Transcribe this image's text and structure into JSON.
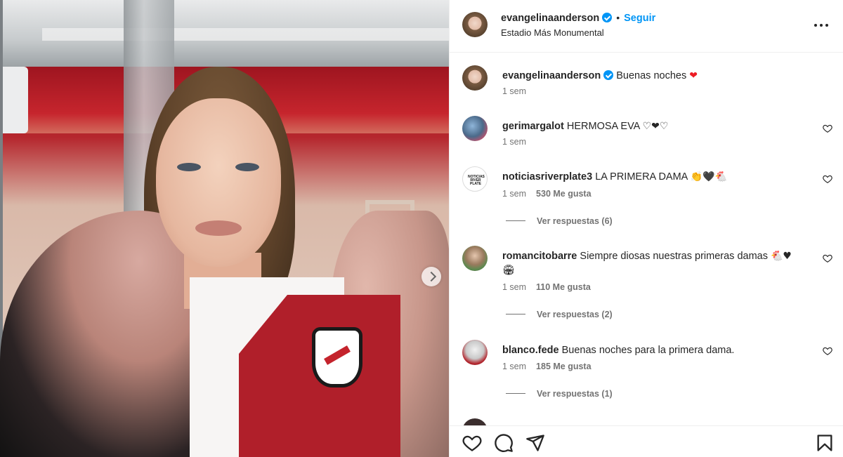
{
  "header": {
    "username": "evangelinaanderson",
    "follow_label": "Seguir",
    "separator": "•",
    "location": "Estadio Más Monumental",
    "more_icon": "more-horizontal-icon"
  },
  "caption": {
    "username": "evangelinaanderson",
    "text": "Buenas noches",
    "emoji": "❤",
    "time": "1 sem"
  },
  "comments": [
    {
      "username": "gerimargalot",
      "text": "HERMOSA EVA",
      "emoji": "♡❤♡",
      "time": "1 sem",
      "likes": ""
    },
    {
      "username": "noticiasriverplate3",
      "text": "LA PRIMERA DAMA",
      "emoji": "👏🖤🐔",
      "time": "1 sem",
      "likes": "530 Me gusta",
      "replies": "Ver respuestas (6)",
      "avatar_text": "NOTICIAS RIVER PLATE"
    },
    {
      "username": "romancitobarre",
      "text": "Siempre diosas nuestras primeras damas",
      "emoji": "🐔♥",
      "emoji2": "🏟",
      "time": "1 sem",
      "likes": "110 Me gusta",
      "replies": "Ver respuestas (2)"
    },
    {
      "username": "blanco.fede",
      "text": "Buenas noches para la primera dama.",
      "emoji": "",
      "time": "1 sem",
      "likes": "185 Me gusta",
      "replies": "Ver respuestas (1)"
    }
  ],
  "icons": {
    "like": "heart-icon",
    "comment": "comment-icon",
    "share": "share-icon",
    "save": "bookmark-icon",
    "carousel_next": "chevron-right-icon"
  },
  "colors": {
    "accent": "#0095f6",
    "verified": "#0095f6",
    "heart": "#ed1c24",
    "secondary_text": "#737373"
  }
}
